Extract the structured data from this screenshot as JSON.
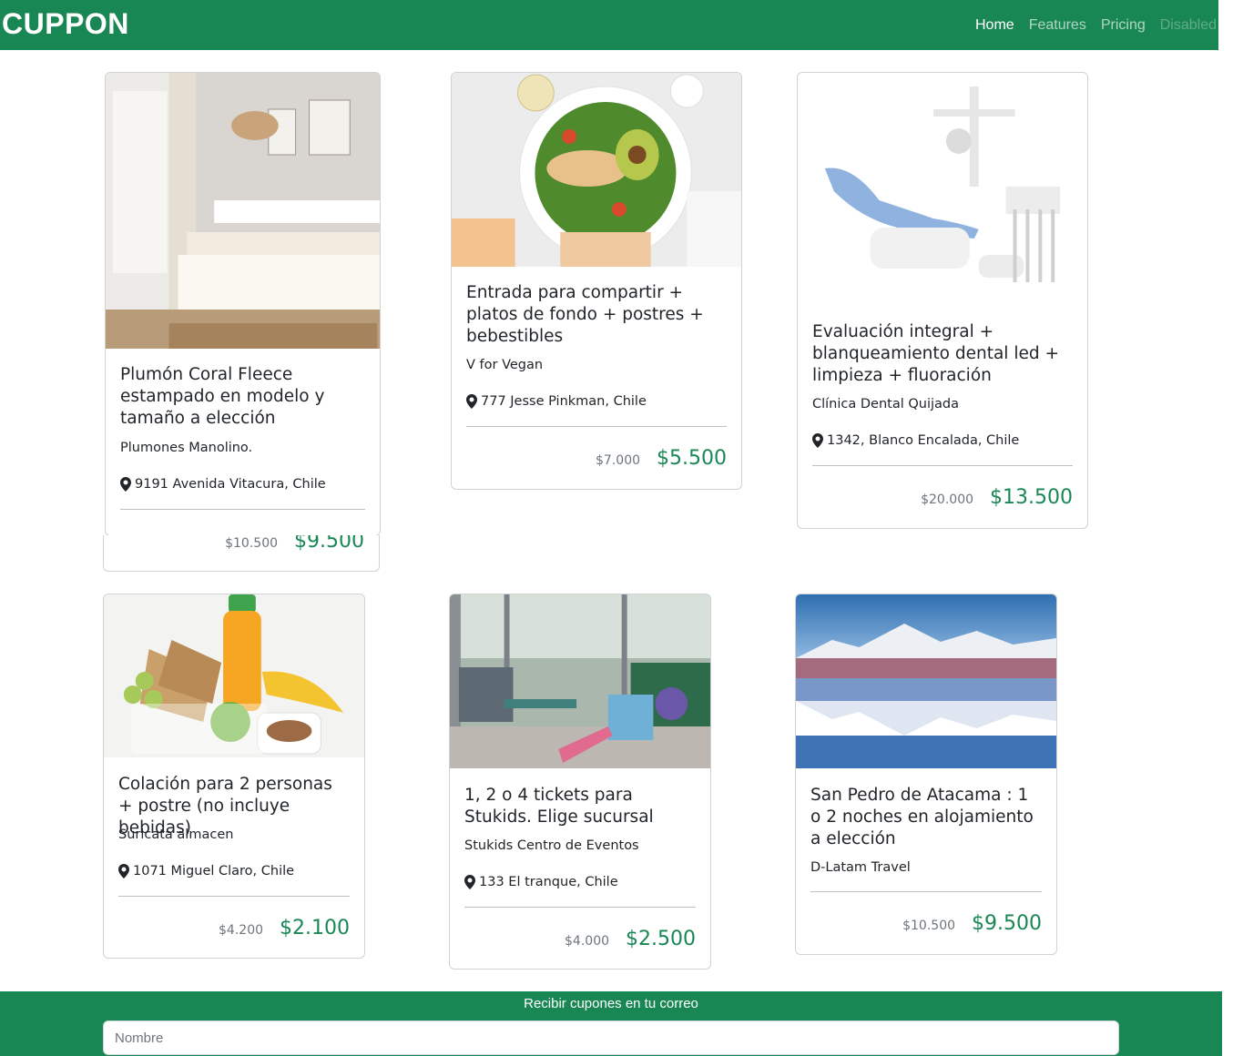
{
  "navbar": {
    "brand": "CUPPON",
    "links": [
      {
        "label": "Home"
      },
      {
        "label": "Features"
      },
      {
        "label": "Pricing"
      },
      {
        "label": "Disabled"
      }
    ]
  },
  "deals": [
    {
      "title": "Plumón Coral Fleece estampado en modelo y tamaño a elección",
      "merchant": "Plumones Manolino.",
      "address": "9191 Avenida Vitacura, Chile",
      "old_price": "$10.500",
      "new_price": "$9.500",
      "image": "bedroom"
    },
    {
      "title": "Entrada para compartir + platos de fondo + postres + bebestibles",
      "merchant": "V for Vegan",
      "address": "777 Jesse Pinkman, Chile",
      "old_price": "$7.000",
      "new_price": "$5.500",
      "image": "salad-bowl"
    },
    {
      "title": "Evaluación integral + blanqueamiento dental led + limpieza + fluoración",
      "merchant": "Clínica Dental Quijada",
      "address": "1342, Blanco Encalada, Chile",
      "old_price": "$20.000",
      "new_price": "$13.500",
      "image": "dental-chair"
    },
    {
      "title": "Colación para 2 personas + postre (no incluye bebidas)",
      "merchant": "Suricata almacen",
      "address": "1071 Miguel Claro, Chile",
      "old_price": "$4.200",
      "new_price": "$2.100",
      "image": "lunch-box"
    },
    {
      "title": "1, 2 o 4 tickets para Stukids. Elige sucursal",
      "merchant": "Stukids Centro de Eventos",
      "address": "133 El tranque, Chile",
      "old_price": "$4.000",
      "new_price": "$2.500",
      "image": "kids-play-area"
    },
    {
      "title": "San Pedro de Atacama : 1 o 2 noches en alojamiento a elección",
      "merchant": "D-Latam Travel",
      "address": "",
      "old_price": "$10.500",
      "new_price": "$9.500",
      "image": "atacama-lagoon"
    }
  ],
  "footer": {
    "heading": "Recibir cupones en tu correo",
    "name_placeholder": "Nombre"
  },
  "colors": {
    "primary": "#198754",
    "muted": "#6c757d"
  },
  "icons": {
    "location": "map-pin-icon"
  }
}
